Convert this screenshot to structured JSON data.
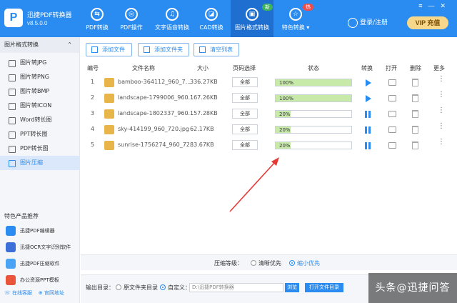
{
  "app": {
    "name": "迅捷PDF转换器",
    "version": "v8.5.0.0",
    "logo_letter": "P"
  },
  "nav": [
    {
      "label": "PDF转换",
      "icon": "convert-icon",
      "glyph": "⇆"
    },
    {
      "label": "PDF操作",
      "icon": "pdf-ops-icon",
      "glyph": "◎"
    },
    {
      "label": "文字语音转换",
      "icon": "audio-icon",
      "glyph": "♫"
    },
    {
      "label": "CAD转换",
      "icon": "cad-icon",
      "glyph": "◪"
    },
    {
      "label": "图片格式转换",
      "icon": "image-icon",
      "glyph": "▣",
      "badge": "新"
    },
    {
      "label": "特色转换",
      "icon": "special-icon",
      "glyph": "☆",
      "badge": "热"
    }
  ],
  "header": {
    "login": "登录/注册",
    "vip": "VIP 充值"
  },
  "sidebar": {
    "section_title": "图片格式转换",
    "items": [
      "图片转JPG",
      "图片转PNG",
      "图片转BMP",
      "图片转ICON",
      "Word转长图",
      "PPT转长图",
      "PDF转长图",
      "图片压缩"
    ],
    "promo_title": "特色产品推荐",
    "promos": [
      "迅捷PDF编辑器",
      "迅捷OCR文字识别软件",
      "迅捷PDF压缩软件",
      "办公资源PPT模板"
    ],
    "footer": {
      "online": "在线客服",
      "website": "官网地址"
    }
  },
  "toolbar": {
    "add_file": "添加文件",
    "add_folder": "添加文件夹",
    "clear_list": "清空列表"
  },
  "table": {
    "headers": [
      "编号",
      "文件名称",
      "大小",
      "页码选择",
      "状态",
      "转换",
      "打开",
      "删除",
      "更多"
    ],
    "rows": [
      {
        "no": "1",
        "name": "bamboo-364112_960_7...",
        "size": "336.27KB",
        "pages": "全部",
        "progress": "100%",
        "progress_value": 1.0,
        "action": "play"
      },
      {
        "no": "2",
        "name": "landscape-1799006_960...",
        "size": "167.26KB",
        "pages": "全部",
        "progress": "100%",
        "progress_value": 1.0,
        "action": "play"
      },
      {
        "no": "3",
        "name": "landscape-1802337_960...",
        "size": "157.28KB",
        "pages": "全部",
        "progress": "20%",
        "progress_value": 0.2,
        "action": "pause"
      },
      {
        "no": "4",
        "name": "sky-414199_960_720.jpg",
        "size": "62.17KB",
        "pages": "全部",
        "progress": "20%",
        "progress_value": 0.2,
        "action": "pause"
      },
      {
        "no": "5",
        "name": "sunrise-1756274_960_72...",
        "size": "83.67KB",
        "pages": "全部",
        "progress": "20%",
        "progress_value": 0.2,
        "action": "pause"
      }
    ]
  },
  "compression": {
    "label": "压缩等级：",
    "option1": "清晰优先",
    "option2": "缩小优先",
    "selected": "缩小优先"
  },
  "output": {
    "label": "输出目录：",
    "original": "原文件夹目录",
    "custom": "自定义：",
    "path": "D:\\迅捷PDF转换器",
    "browse": "浏览",
    "open_folder": "打开文件目录"
  },
  "watermark": "头条@迅捷问答",
  "colors": {
    "primary": "#2a8cf0",
    "progress_fill": "#c7eaa9",
    "arrow": "#e53935"
  }
}
